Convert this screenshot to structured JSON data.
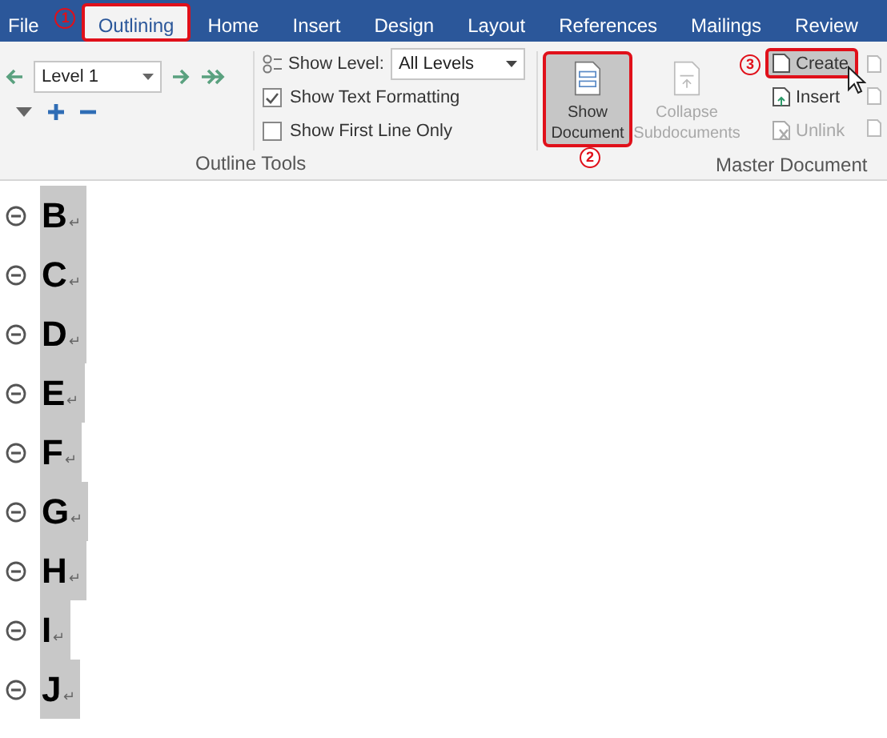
{
  "tabs": [
    {
      "label": "File",
      "selected": false,
      "highlighted": false
    },
    {
      "label": "Outlining",
      "selected": true,
      "highlighted": true,
      "step": "1"
    },
    {
      "label": "Home",
      "selected": false,
      "highlighted": false
    },
    {
      "label": "Insert",
      "selected": false,
      "highlighted": false
    },
    {
      "label": "Design",
      "selected": false,
      "highlighted": false
    },
    {
      "label": "Layout",
      "selected": false,
      "highlighted": false
    },
    {
      "label": "References",
      "selected": false,
      "highlighted": false
    },
    {
      "label": "Mailings",
      "selected": false,
      "highlighted": false
    },
    {
      "label": "Review",
      "selected": false,
      "highlighted": false
    }
  ],
  "outline_tools": {
    "level_dropdown": {
      "value": "Level 1"
    },
    "show_level": {
      "label": "Show Level:",
      "value": "All Levels"
    },
    "checkboxes": [
      {
        "label": "Show Text Formatting",
        "checked": true
      },
      {
        "label": "Show First Line Only",
        "checked": false
      }
    ],
    "group_label": "Outline Tools"
  },
  "master_document": {
    "buttons": [
      {
        "kind": "large",
        "label": "Show Document",
        "pressed": true,
        "highlighted": true,
        "disabled": false,
        "step": "2"
      },
      {
        "kind": "large",
        "label": "Collapse Subdocuments",
        "pressed": false,
        "highlighted": false,
        "disabled": true
      },
      {
        "kind": "small",
        "label": "Create",
        "pressed": true,
        "highlighted": true,
        "disabled": false,
        "step": "3"
      },
      {
        "kind": "small",
        "label": "Insert",
        "pressed": false,
        "highlighted": false,
        "disabled": false
      },
      {
        "kind": "small",
        "label": "Unlink",
        "pressed": false,
        "highlighted": false,
        "disabled": true
      }
    ],
    "group_label": "Master Document"
  },
  "headings": [
    {
      "text": "B",
      "mark": "↵"
    },
    {
      "text": "C",
      "mark": "↵"
    },
    {
      "text": "D",
      "mark": "↵"
    },
    {
      "text": "E",
      "mark": "↵"
    },
    {
      "text": "F",
      "mark": "↵"
    },
    {
      "text": "G",
      "mark": "↵"
    },
    {
      "text": "H",
      "mark": "↵"
    },
    {
      "text": "I",
      "mark": "↵"
    },
    {
      "text": "J",
      "mark": "↵"
    }
  ]
}
